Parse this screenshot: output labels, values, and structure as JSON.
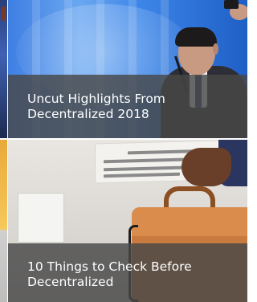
{
  "articles": [
    {
      "title": "Uncut Highlights From Decentralized 2018"
    },
    {
      "title": "10 Things to Check Before Decentralized"
    }
  ]
}
